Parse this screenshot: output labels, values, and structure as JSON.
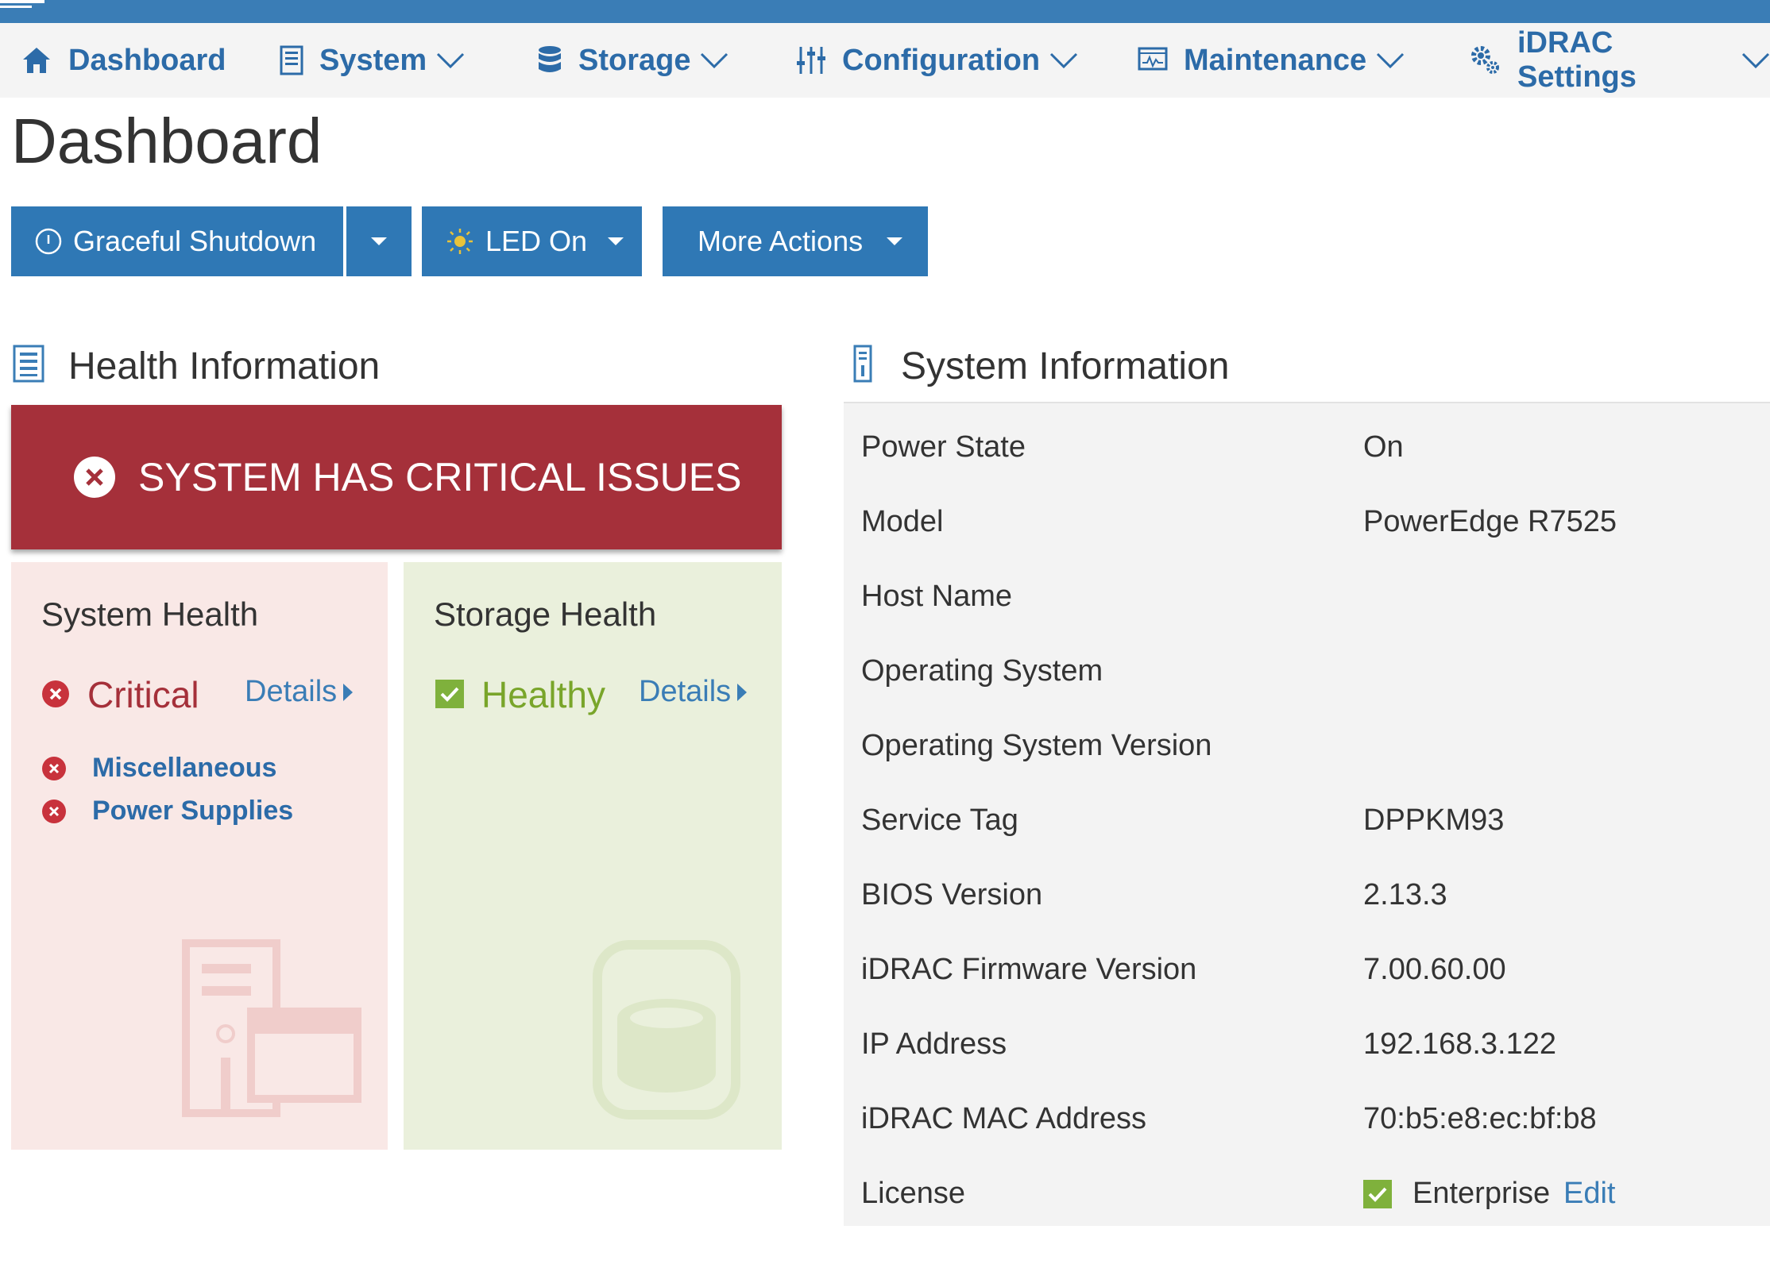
{
  "colors": {
    "brand_blue": "#3a7db6",
    "nav_text": "#2c6ba8",
    "button_blue": "#2f78b5",
    "critical_red": "#a5303a",
    "status_red": "#c8323c",
    "healthy_green": "#79a52a",
    "check_green": "#7fb13c",
    "system_card_bg": "#f9e8e6",
    "storage_card_bg": "#eaf0dc",
    "info_panel_bg": "#f3f3f3"
  },
  "nav": {
    "items": [
      {
        "label": "Dashboard",
        "icon": "home-icon",
        "has_dropdown": false
      },
      {
        "label": "System",
        "icon": "server-icon",
        "has_dropdown": true
      },
      {
        "label": "Storage",
        "icon": "database-icon",
        "has_dropdown": true
      },
      {
        "label": "Configuration",
        "icon": "sliders-icon",
        "has_dropdown": true
      },
      {
        "label": "Maintenance",
        "icon": "monitor-pulse-icon",
        "has_dropdown": true
      },
      {
        "label": "iDRAC Settings",
        "icon": "gears-icon",
        "has_dropdown": true
      }
    ]
  },
  "page": {
    "title": "Dashboard"
  },
  "actions": {
    "graceful_shutdown": "Graceful Shutdown",
    "led_on": "LED On",
    "more_actions": "More Actions"
  },
  "health": {
    "title": "Health Information",
    "banner": "SYSTEM HAS CRITICAL ISSUES",
    "system": {
      "title": "System Health",
      "status": "Critical",
      "details": "Details",
      "items": [
        "Miscellaneous",
        "Power Supplies"
      ]
    },
    "storage": {
      "title": "Storage Health",
      "status": "Healthy",
      "details": "Details"
    }
  },
  "system_info": {
    "title": "System Information",
    "rows": [
      {
        "label": "Power State",
        "value": "On"
      },
      {
        "label": "Model",
        "value": "PowerEdge R7525"
      },
      {
        "label": "Host Name",
        "value": ""
      },
      {
        "label": "Operating System",
        "value": ""
      },
      {
        "label": "Operating System Version",
        "value": ""
      },
      {
        "label": "Service Tag",
        "value": "DPPKM93"
      },
      {
        "label": "BIOS Version",
        "value": "2.13.3"
      },
      {
        "label": "iDRAC Firmware Version",
        "value": "7.00.60.00"
      },
      {
        "label": "IP Address",
        "value": "192.168.3.122"
      },
      {
        "label": "iDRAC MAC Address",
        "value": "70:b5:e8:ec:bf:b8"
      },
      {
        "label": "License",
        "value": "Enterprise"
      }
    ],
    "license_edit": "Edit"
  }
}
